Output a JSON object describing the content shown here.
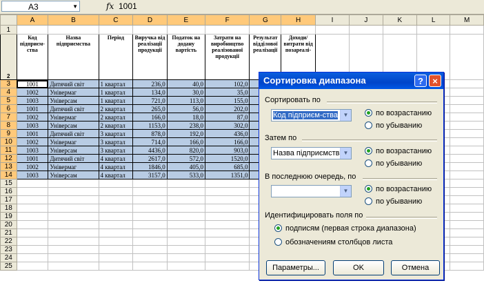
{
  "formula_bar": {
    "cell_ref": "A3",
    "fx": "fx",
    "content": "1001"
  },
  "columns": [
    "A",
    "B",
    "C",
    "D",
    "E",
    "F",
    "G",
    "H",
    "I",
    "J",
    "K",
    "L",
    "M"
  ],
  "header_row": {
    "A": "Код підприєм-ства",
    "B": "Назва підприємства",
    "C": "Період",
    "D": "Виручка від реалізації продукції",
    "E": "Податок на додану вартість",
    "F": "Затрати на виробництво реалізованої продукції",
    "G": "Результат відділової реалізації",
    "H": "Доходи/ витрати від позареалі-"
  },
  "rows": [
    {
      "n": "3",
      "a": "1001",
      "b": "Дитячий світ",
      "c": "1 квартал",
      "d": "236,0",
      "e": "40,0",
      "f": "102,0"
    },
    {
      "n": "4",
      "a": "1002",
      "b": "Універмаг",
      "c": "1 квартал",
      "d": "134,0",
      "e": "30,0",
      "f": "35,0"
    },
    {
      "n": "5",
      "a": "1003",
      "b": "Універсам",
      "c": "1 квартал",
      "d": "721,0",
      "e": "113,0",
      "f": "155,0"
    },
    {
      "n": "6",
      "a": "1001",
      "b": "Дитячий світ",
      "c": "2 квартал",
      "d": "265,0",
      "e": "56,0",
      "f": "202,0"
    },
    {
      "n": "7",
      "a": "1002",
      "b": "Універмаг",
      "c": "2 квартал",
      "d": "166,0",
      "e": "18,0",
      "f": "87,0"
    },
    {
      "n": "8",
      "a": "1003",
      "b": "Універсам",
      "c": "2 квартал",
      "d": "1153,0",
      "e": "238,0",
      "f": "302,0"
    },
    {
      "n": "9",
      "a": "1001",
      "b": "Дитячий світ",
      "c": "3 квартал",
      "d": "878,0",
      "e": "192,0",
      "f": "436,0"
    },
    {
      "n": "10",
      "a": "1002",
      "b": "Універмаг",
      "c": "3 квартал",
      "d": "714,0",
      "e": "166,0",
      "f": "166,0"
    },
    {
      "n": "11",
      "a": "1003",
      "b": "Універсам",
      "c": "3 квартал",
      "d": "4436,0",
      "e": "820,0",
      "f": "903,0"
    },
    {
      "n": "12",
      "a": "1001",
      "b": "Дитячий світ",
      "c": "4 квартал",
      "d": "2617,0",
      "e": "572,0",
      "f": "1520,0"
    },
    {
      "n": "13",
      "a": "1002",
      "b": "Універмаг",
      "c": "4 квартал",
      "d": "1846,0",
      "e": "405,0",
      "f": "685,0"
    },
    {
      "n": "14",
      "a": "1003",
      "b": "Універсам",
      "c": "4 квартал",
      "d": "3157,0",
      "e": "533,0",
      "f": "1351,0"
    }
  ],
  "empty_rows": [
    "15",
    "16",
    "17",
    "18",
    "19",
    "20",
    "21",
    "22",
    "23",
    "24",
    "25"
  ],
  "dialog": {
    "title": "Сортировка диапазона",
    "help": "?",
    "close": "×",
    "sort_by_label": "Сортировать по",
    "sort_by_value": "Код підприєм-ства",
    "then_by_label": "Затем по",
    "then_by_value": "Назва підприємства",
    "last_by_label": "В последнюю очередь, по",
    "last_by_value": "",
    "asc": "по возрастанию",
    "desc": "по убыванию",
    "identify_label": "Идентифицировать поля по",
    "by_labels": "подписям (первая строка диапазона)",
    "by_columns": "обозначениям столбцов листа",
    "params_button": "Параметры...",
    "ok_button": "OK",
    "cancel_button": "Отмена"
  },
  "colors": {
    "selection": "#b8cce4",
    "title_bar": "#0a5fde",
    "dialog_bg": "#ece9d8"
  }
}
